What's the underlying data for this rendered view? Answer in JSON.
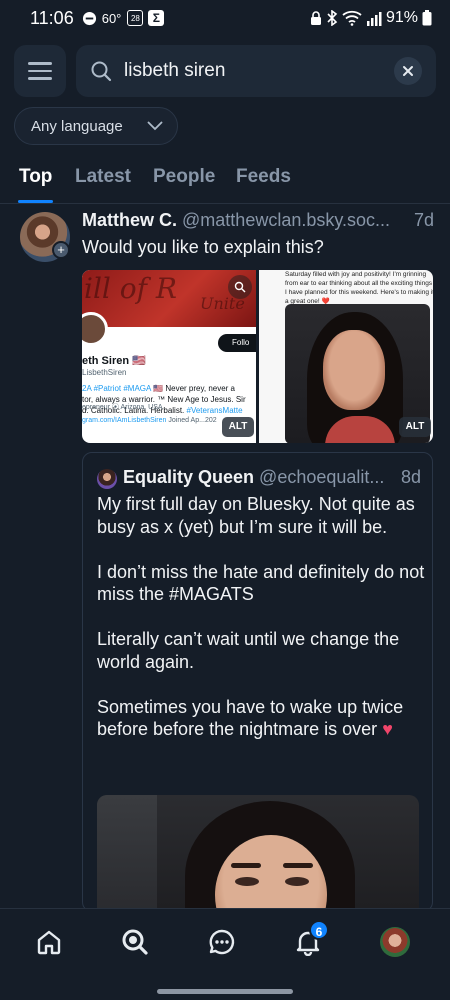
{
  "status_bar": {
    "time": "11:06",
    "temperature": "60°",
    "calendar_day": "28",
    "battery": "91%"
  },
  "search": {
    "query": "lisbeth siren"
  },
  "language_filter": {
    "label": "Any language"
  },
  "tabs": [
    {
      "label": "Top",
      "active": true
    },
    {
      "label": "Latest",
      "active": false
    },
    {
      "label": "People",
      "active": false
    },
    {
      "label": "Feeds",
      "active": false
    }
  ],
  "post": {
    "author_name": "Matthew C.",
    "author_handle": "@matthewclan.bsky.soc...",
    "age": "7d",
    "text": "Would you like to explain this?",
    "image1": {
      "banner_text": "ill of R",
      "banner_text_2": "Unite",
      "follow_label": "Follo",
      "profile_name": "eth Siren 🇺🇸",
      "profile_handle": "LisbethSiren",
      "bio_line1_links": "2A #Patriot #MAGA",
      "bio_line1_text": " 🇺🇸 Never prey, never a",
      "bio_line2": "tor, always a warrior. ™ New Age to Jesus. Sir",
      "bio_line3_text": "d. Catholic. Latina. Herbalist. ",
      "bio_line3_link": "#VeteransMatte",
      "meta_line1": "epreneur   ⦿ Arizona, USA",
      "meta_link": "gram.com/IAmLisbethSiren",
      "meta_joined": "  Joined Ap...202",
      "alt": "ALT"
    },
    "image2": {
      "caption": "Saturday filled with joy and positivity! I'm grinning from ear to ear thinking about all the exciting things I have planned for this weekend. Here's to making it a great one! ❤️",
      "alt": "ALT"
    },
    "quote": {
      "author_name": "Equality Queen",
      "author_handle": "@echoequalit...",
      "age": "8d",
      "paragraphs": [
        "My first full day on Bluesky.  Not quite as busy as x (yet) but I’m sure it will be.",
        "I don’t miss the hate and definitely do not miss the #MAGATS",
        "Literally can’t wait until we change the world again.",
        "Sometimes you have to wake up twice before before the nightmare is over"
      ],
      "heart": "♥"
    }
  },
  "bottom_nav": {
    "notifications_count": "6",
    "items": [
      "home-icon",
      "search-icon",
      "chat-icon",
      "bell-icon",
      "avatar"
    ]
  },
  "colors": {
    "background": "#151d28",
    "accent": "#1083fe",
    "muted_text": "#8896a8"
  }
}
